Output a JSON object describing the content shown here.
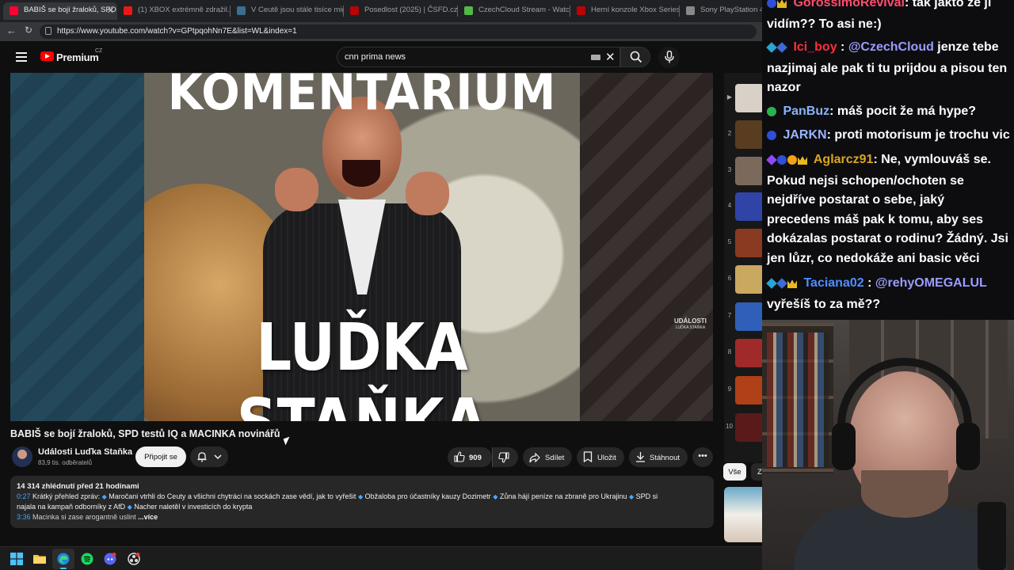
{
  "browser": {
    "tabs": [
      {
        "title": "BABIŠ se bojí žraloků, SPD te",
        "favicon_color": "#ff0033",
        "active": true
      },
      {
        "title": "(1) XBOX extrémně zdražil. ",
        "favicon_color": "#e91916",
        "active": false
      },
      {
        "title": "V Ceutě jsou stále tisíce mig",
        "favicon_color": "#3c6e8f",
        "active": false
      },
      {
        "title": "Posedlost (2025) | ČSFD.cz",
        "favicon_color": "#ba0305",
        "active": false
      },
      {
        "title": "CzechCloud Stream - Watch",
        "favicon_color": "#53b848",
        "active": false
      },
      {
        "title": "Herní konzole Xbox Series |",
        "favicon_color": "#ba0305",
        "active": false
      },
      {
        "title": "Sony PlayStation 4 Slim,",
        "favicon_color": "#888888",
        "active": false
      }
    ],
    "url": "https://www.youtube.com/watch?v=GPtpqohNn7E&list=WL&index=1"
  },
  "youtube": {
    "brand": "Premium",
    "country": "CZ",
    "search_query": "cnn prima news"
  },
  "thumbnail": {
    "top_text": "KOMENTÁŘIUM",
    "name_text": "LUĎKA STAŇKA",
    "watermark": "UDÁLOSTI",
    "watermark_sub": "LUĎKA STAŇKA"
  },
  "video": {
    "title": "BABIŠ se bojí žraloků, SPD testů IQ a MACINKA novinářů",
    "channel_name": "Události Luďka Staňka",
    "channel_subs": "83,9 tis. odběratelů",
    "join_label": "Připojit se",
    "likes": "909",
    "share_label": "Sdílet",
    "save_label": "Uložit",
    "download_label": "Stáhnout",
    "more_label": "•••"
  },
  "description": {
    "stats": "14 314 zhlédnutí  před 21 hodinami",
    "line1_ts": "0:27",
    "line1_a": "Krátký přehled zpráv:",
    "line1_b": "Maročani vtrhli do Ceuty a všichni chytráci na sockách zase vědí, jak to vyřešit",
    "line1_c": "Obžaloba pro účastníky kauzy Dozimetr",
    "line1_d": "Zůna hájí peníze na zbraně pro Ukrajinu",
    "line1_e": "SPD si",
    "line2_a": "najala na kampaň odborníky z AfD",
    "line2_b": "Nacher naletěl v investicích do krypta",
    "line3_ts": "3:36",
    "line3_a": "Macinka si zase arogantně uslint",
    "more": "...více"
  },
  "playlist": {
    "numbers": [
      "",
      "2",
      "3",
      "4",
      "5",
      "6",
      "7",
      "8",
      "9",
      "10"
    ],
    "thumb_colors": [
      "#d9d0c8",
      "#5a3c20",
      "#7b6a5c",
      "#3044a8",
      "#8a3a20",
      "#c9a860",
      "#2f5fb8",
      "#a02a2a",
      "#b04018",
      "#5a1a1a"
    ],
    "chip_all": "Vše",
    "chip_second": "Z"
  },
  "chat": {
    "messages": [
      {
        "author": "GorossimoRevival",
        "author_color": "#ff4d6d",
        "text": ": tak jakto že jí vidím?? To asi ne:)"
      },
      {
        "author": "Ici_boy",
        "author_color": "#ff2e3b",
        "mention": "@CzechCloud",
        "text": " jenze tebe nazjimaj ale pak ti tu prijdou a pisou ten nazor"
      },
      {
        "author": "PanBuz",
        "author_color": "#8ab4f8",
        "text": ": máš pocit že má hype?"
      },
      {
        "author": "JARKN",
        "author_color": "#9ab3ff",
        "text": ": proti motorisum je trochu vic"
      },
      {
        "author": "Aglarcz91",
        "author_color": "#daa520",
        "text": ": Ne, vymlouváš se. Pokud nejsi schopen/ochoten se nejdříve postarat o sebe, jaký precedens máš pak k tomu, aby ses dokázalas postarat o rodinu? Žádný. Jsi jen lůzr, co nedokáže ani basic věci"
      },
      {
        "author": "Taciana02",
        "author_color": "#4f8fff",
        "mention": "@rehyOMEGALUL",
        "text": " vyřešíš to za mě??"
      }
    ]
  }
}
